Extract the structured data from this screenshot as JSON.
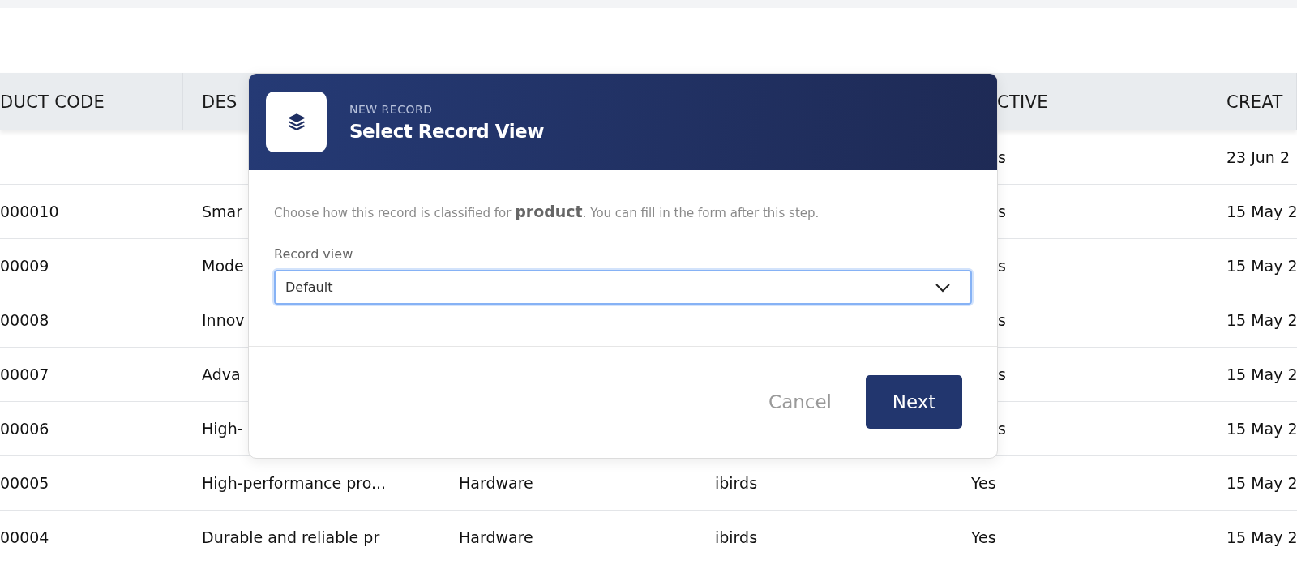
{
  "table": {
    "columns": [
      {
        "label": "DUCT CODE"
      },
      {
        "label": "DES"
      },
      {},
      {},
      {
        "label": "CTIVE",
        "clipped": true
      },
      {
        "label": "CREAT"
      }
    ],
    "rows": [
      [
        null,
        null,
        null,
        null,
        {
          "text": "s",
          "clipped": true
        },
        {
          "text": "23 Jun 2"
        }
      ],
      [
        {
          "text": "000010"
        },
        {
          "text": "Smar"
        },
        null,
        null,
        {
          "text": "s",
          "clipped": true
        },
        {
          "text": "15 May 2"
        }
      ],
      [
        {
          "text": "00009"
        },
        {
          "text": "Mode"
        },
        null,
        null,
        {
          "text": "s",
          "clipped": true
        },
        {
          "text": "15 May 2"
        }
      ],
      [
        {
          "text": "00008"
        },
        {
          "text": "Innov"
        },
        null,
        null,
        {
          "text": "s",
          "clipped": true
        },
        {
          "text": "15 May 2"
        }
      ],
      [
        {
          "text": "00007"
        },
        {
          "text": "Adva"
        },
        null,
        null,
        {
          "text": "s",
          "clipped": true
        },
        {
          "text": "15 May 2"
        }
      ],
      [
        {
          "text": "00006"
        },
        {
          "text": "High-"
        },
        null,
        null,
        {
          "text": "s",
          "clipped": true
        },
        {
          "text": "15 May 2"
        }
      ],
      [
        {
          "text": "00005"
        },
        {
          "text": "High-performance pro..."
        },
        {
          "text": "Hardware"
        },
        {
          "text": "ibirds"
        },
        {
          "text": "Yes"
        },
        {
          "text": "15 May 2"
        }
      ],
      [
        {
          "text": "00004"
        },
        {
          "text": "Durable and reliable pr"
        },
        {
          "text": "Hardware"
        },
        {
          "text": "ibirds"
        },
        {
          "text": "Yes"
        },
        {
          "text": "15 May 2"
        }
      ]
    ]
  },
  "dialog": {
    "kicker": "NEW RECORD",
    "title": "Select Record View",
    "description": "Choose how this record is classified for **product**. You can fill in the form after this step.",
    "field": {
      "label": "Record view",
      "value": "Default",
      "focused": true
    },
    "buttons": [
      {
        "label": "Cancel",
        "kind": "secondary"
      },
      {
        "label": "Next",
        "kind": "primary"
      }
    ]
  }
}
